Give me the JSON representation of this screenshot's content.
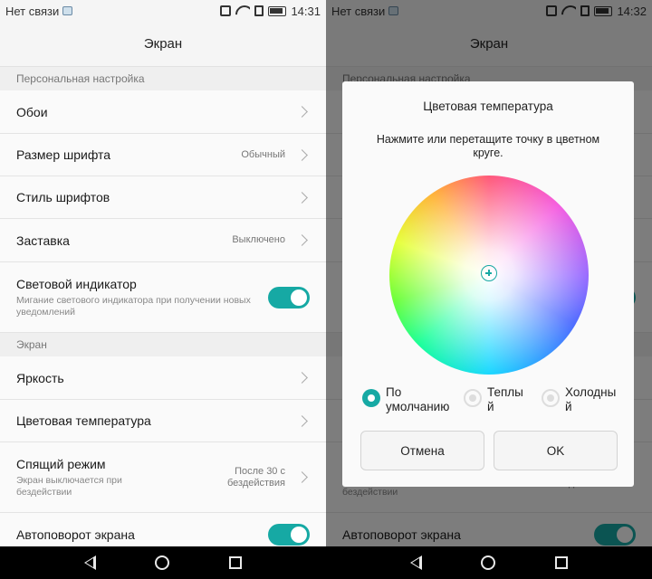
{
  "status": {
    "carrier": "Нет связи",
    "time_left": "14:31",
    "time_right": "14:32"
  },
  "header": {
    "title": "Экран"
  },
  "sections": {
    "personal": "Персональная настройка",
    "screen": "Экран"
  },
  "settings": {
    "wallpaper": {
      "label": "Обои"
    },
    "font_size": {
      "label": "Размер шрифта",
      "value": "Обычный"
    },
    "font_style": {
      "label": "Стиль шрифтов"
    },
    "screensaver": {
      "label": "Заставка",
      "value": "Выключено"
    },
    "indicator": {
      "label": "Световой индикатор",
      "description": "Мигание светового индикатора при получении новых уведомлений",
      "enabled": true
    },
    "brightness": {
      "label": "Яркость"
    },
    "color_temp": {
      "label": "Цветовая температура"
    },
    "sleep": {
      "label": "Спящий режим",
      "description": "Экран выключается при бездействии",
      "value": "После 30 с бездействия"
    },
    "autorotate": {
      "label": "Автоповорот экрана",
      "enabled": true
    }
  },
  "dialog": {
    "title": "Цветовая температура",
    "message": "Нажмите или перетащите точку в цветном круге.",
    "options": [
      {
        "label": "По умолчанию",
        "selected": true
      },
      {
        "label": "Теплый",
        "selected": false
      },
      {
        "label": "Холодный",
        "selected": false
      }
    ],
    "cancel_label": "Отмена",
    "ok_label": "OK"
  },
  "colors": {
    "accent": "#16a9a4"
  }
}
